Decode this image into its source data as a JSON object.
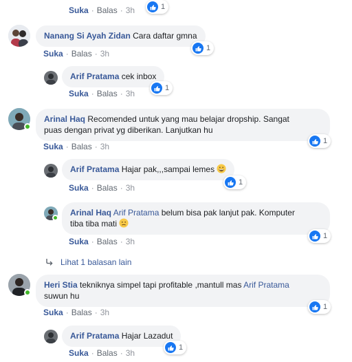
{
  "actions": {
    "like": "Suka",
    "reply": "Balas"
  },
  "comments": [
    {
      "id": "c0",
      "actions": {
        "time": "3h"
      },
      "reactions": {
        "count": "1"
      }
    },
    {
      "id": "c1",
      "author": "Nanang Si Ayah Zidan",
      "text": "Cara daftar gmna",
      "actions": {
        "time": "3h"
      },
      "reactions": {
        "count": "1"
      },
      "avatar_icon": "avatar-couple-icon",
      "replies": [
        {
          "author": "Arif Pratama",
          "text": "cek inbox",
          "time": "3h",
          "count": "1",
          "avatar_icon": "avatar-man-icon"
        }
      ]
    },
    {
      "id": "c2",
      "author": "Arinal Haq",
      "text_line1": "Recomended untuk yang mau belajar dropship. Sangat",
      "text_line2": "puas dengan privat yg diberikan. Lanjutkan hu",
      "actions": {
        "time": "3h"
      },
      "reactions": {
        "count": "1"
      },
      "avatar_icon": "avatar-man-icon",
      "replies": [
        {
          "author": "Arif Pratama",
          "text": "Hajar pak,,,sampai lemes",
          "emoji": "grin-emoji-icon",
          "time": "3h",
          "count": "1",
          "avatar_icon": "avatar-man-icon"
        },
        {
          "author": "Arinal Haq",
          "mention": "Arif Pratama",
          "text_line1": " belum bisa pak lanjut pak. Komputer",
          "text_line2": "tiba tiba mati",
          "emoji": "confused-emoji-icon",
          "time": "3h",
          "count": "1",
          "avatar_icon": "avatar-man-icon"
        }
      ],
      "more_replies": "Lihat 1 balasan lain"
    },
    {
      "id": "c3",
      "author": "Heri Stia",
      "text_line1": " tekniknya simpel tapi profitable ,mantull mas ",
      "mention": "Arif Pratama",
      "text_line2": "suwun hu",
      "actions": {
        "time": "3h"
      },
      "reactions": {
        "count": "1"
      },
      "avatar_icon": "avatar-man-icon",
      "replies": [
        {
          "author": "Arif Pratama",
          "text": "Hajar Lazadut",
          "time": "3h",
          "count": "1",
          "avatar_icon": "avatar-man-icon"
        }
      ]
    }
  ],
  "colors": {
    "link": "#385898",
    "like": "#1877f2",
    "bubble": "#f2f3f5",
    "online": "#42b72a"
  }
}
